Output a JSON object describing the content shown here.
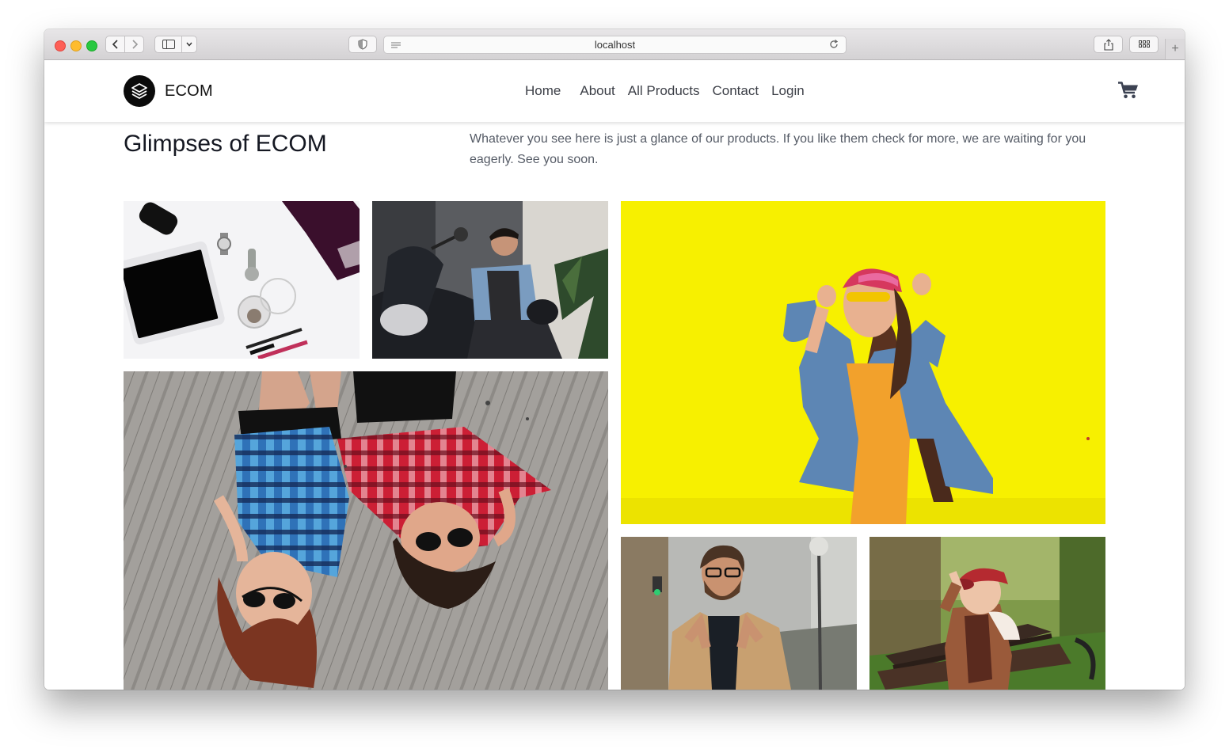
{
  "browser": {
    "url": "localhost"
  },
  "navbar": {
    "brand": "ECOM",
    "links": [
      "Home",
      "About",
      "All Products",
      "Contact",
      "Login"
    ]
  },
  "gallery": {
    "title": "Glimpses of ECOM",
    "description": "Whatever you see here is just a glance of our products. If you like them check for more, we are waiting for you eagerly. See you soon.",
    "images": [
      {
        "name": "tablet-accessories"
      },
      {
        "name": "man-on-motorcycle"
      },
      {
        "name": "woman-yellow-wall"
      },
      {
        "name": "two-girls-lying"
      },
      {
        "name": "man-in-coat"
      },
      {
        "name": "boy-on-bench"
      }
    ]
  },
  "colors": {
    "yellow_wall": "#f7f000",
    "text_dark": "#151822",
    "nav_text": "#3c3f47"
  },
  "icons": [
    "layers-logo-icon",
    "shopping-cart-icon",
    "reload-icon",
    "share-icon",
    "tabs-grid-icon"
  ]
}
